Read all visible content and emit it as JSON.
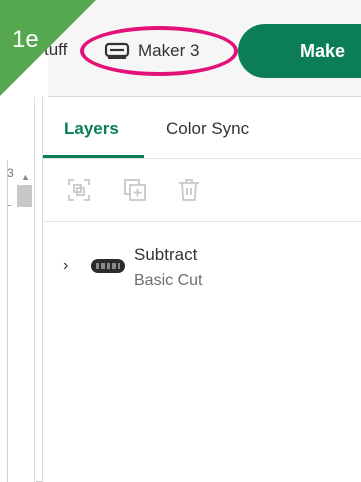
{
  "step_badge": {
    "label": "1e",
    "color": "#55a84f"
  },
  "header": {
    "partial_text": "tuff",
    "machine_icon": "cutting-machine-icon",
    "machine_label": "Maker 3",
    "make_button_label": "Make",
    "highlight_color": "#e3127b"
  },
  "ruler": {
    "number": "3",
    "up_arrow": "▲"
  },
  "tabs": [
    {
      "label": "Layers",
      "active": true
    },
    {
      "label": "Color Sync",
      "active": false
    }
  ],
  "actions": [
    {
      "icon": "group-icon",
      "enabled": false
    },
    {
      "icon": "duplicate-icon",
      "enabled": false
    },
    {
      "icon": "trash-icon",
      "enabled": false
    }
  ],
  "layers": [
    {
      "expand_icon": "›",
      "name": "Subtract",
      "operation": "Basic Cut"
    }
  ],
  "colors": {
    "brand_green": "#0b7e55",
    "icon_disabled": "#c9c9c9"
  }
}
